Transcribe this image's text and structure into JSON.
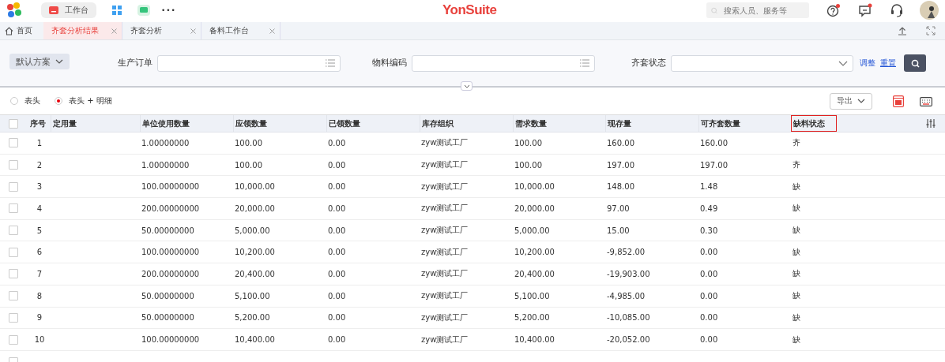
{
  "top_bar": {
    "logo": "YonSuite",
    "apps": [
      {
        "label": "工作台",
        "selected": true
      }
    ],
    "more": "•••",
    "search": {
      "placeholder": "搜索人员、服务等"
    }
  },
  "tabs": [
    {
      "label": "首页",
      "kind": "home",
      "selected": false
    },
    {
      "label": "齐套分析结果",
      "kind": "tab",
      "selected": true
    },
    {
      "label": "齐套分析",
      "kind": "tab",
      "selected": false
    },
    {
      "label": "备料工作台",
      "kind": "tab",
      "selected": false
    }
  ],
  "filter": {
    "scheme": "默认方案",
    "fields": [
      {
        "label": "生产订单",
        "kind": "ref"
      },
      {
        "label": "物料编码",
        "kind": "ref"
      },
      {
        "label": "齐套状态",
        "kind": "select"
      }
    ],
    "links": [
      "调整",
      "重置"
    ]
  },
  "view_options": [
    {
      "label": "表头",
      "selected": false
    },
    {
      "label": "表头 + 明细",
      "selected": true
    }
  ],
  "export_button": "导出",
  "table": {
    "select_all": {
      "checked": false
    },
    "columns": [
      {
        "label": "序号",
        "highlighted": false
      },
      {
        "label": "定用量",
        "highlighted": false
      },
      {
        "label": "单位使用数量",
        "highlighted": false
      },
      {
        "label": "应领数量",
        "highlighted": false
      },
      {
        "label": "已领数量",
        "highlighted": false
      },
      {
        "label": "库存组织",
        "highlighted": false
      },
      {
        "label": "需求数量",
        "highlighted": false
      },
      {
        "label": "现存量",
        "highlighted": false
      },
      {
        "label": "可齐套数量",
        "highlighted": false
      },
      {
        "label": "缺料状态",
        "highlighted": true
      }
    ],
    "rows": [
      {
        "checked": false,
        "cells": [
          "1",
          "",
          "1.00000000",
          "100.00",
          "0.00",
          "zyw测试工厂",
          "100.00",
          "160.00",
          "160.00",
          "齐"
        ]
      },
      {
        "checked": false,
        "cells": [
          "2",
          "",
          "1.00000000",
          "100.00",
          "0.00",
          "zyw测试工厂",
          "100.00",
          "197.00",
          "197.00",
          "齐"
        ]
      },
      {
        "checked": false,
        "cells": [
          "3",
          "",
          "100.00000000",
          "10,000.00",
          "0.00",
          "zyw测试工厂",
          "10,000.00",
          "148.00",
          "1.48",
          "缺"
        ]
      },
      {
        "checked": false,
        "cells": [
          "4",
          "",
          "200.00000000",
          "20,000.00",
          "0.00",
          "zyw测试工厂",
          "20,000.00",
          "97.00",
          "0.49",
          "缺"
        ]
      },
      {
        "checked": false,
        "cells": [
          "5",
          "",
          "50.00000000",
          "5,000.00",
          "0.00",
          "zyw测试工厂",
          "5,000.00",
          "15.00",
          "0.30",
          "缺"
        ]
      },
      {
        "checked": false,
        "cells": [
          "6",
          "",
          "100.00000000",
          "10,200.00",
          "0.00",
          "zyw测试工厂",
          "10,200.00",
          "-9,852.00",
          "0.00",
          "缺"
        ]
      },
      {
        "checked": false,
        "cells": [
          "7",
          "",
          "200.00000000",
          "20,400.00",
          "0.00",
          "zyw测试工厂",
          "20,400.00",
          "-19,903.00",
          "0.00",
          "缺"
        ]
      },
      {
        "checked": false,
        "cells": [
          "8",
          "",
          "50.00000000",
          "5,100.00",
          "0.00",
          "zyw测试工厂",
          "5,100.00",
          "-4,985.00",
          "0.00",
          "缺"
        ]
      },
      {
        "checked": false,
        "cells": [
          "9",
          "",
          "50.00000000",
          "5,200.00",
          "0.00",
          "zyw测试工厂",
          "5,200.00",
          "-10,085.00",
          "0.00",
          "缺"
        ]
      },
      {
        "checked": false,
        "cells": [
          "10",
          "",
          "100.00000000",
          "10,400.00",
          "0.00",
          "zyw测试工厂",
          "10,400.00",
          "-20,052.00",
          "0.00",
          "缺"
        ]
      },
      {
        "checked": false,
        "cells": []
      }
    ]
  }
}
